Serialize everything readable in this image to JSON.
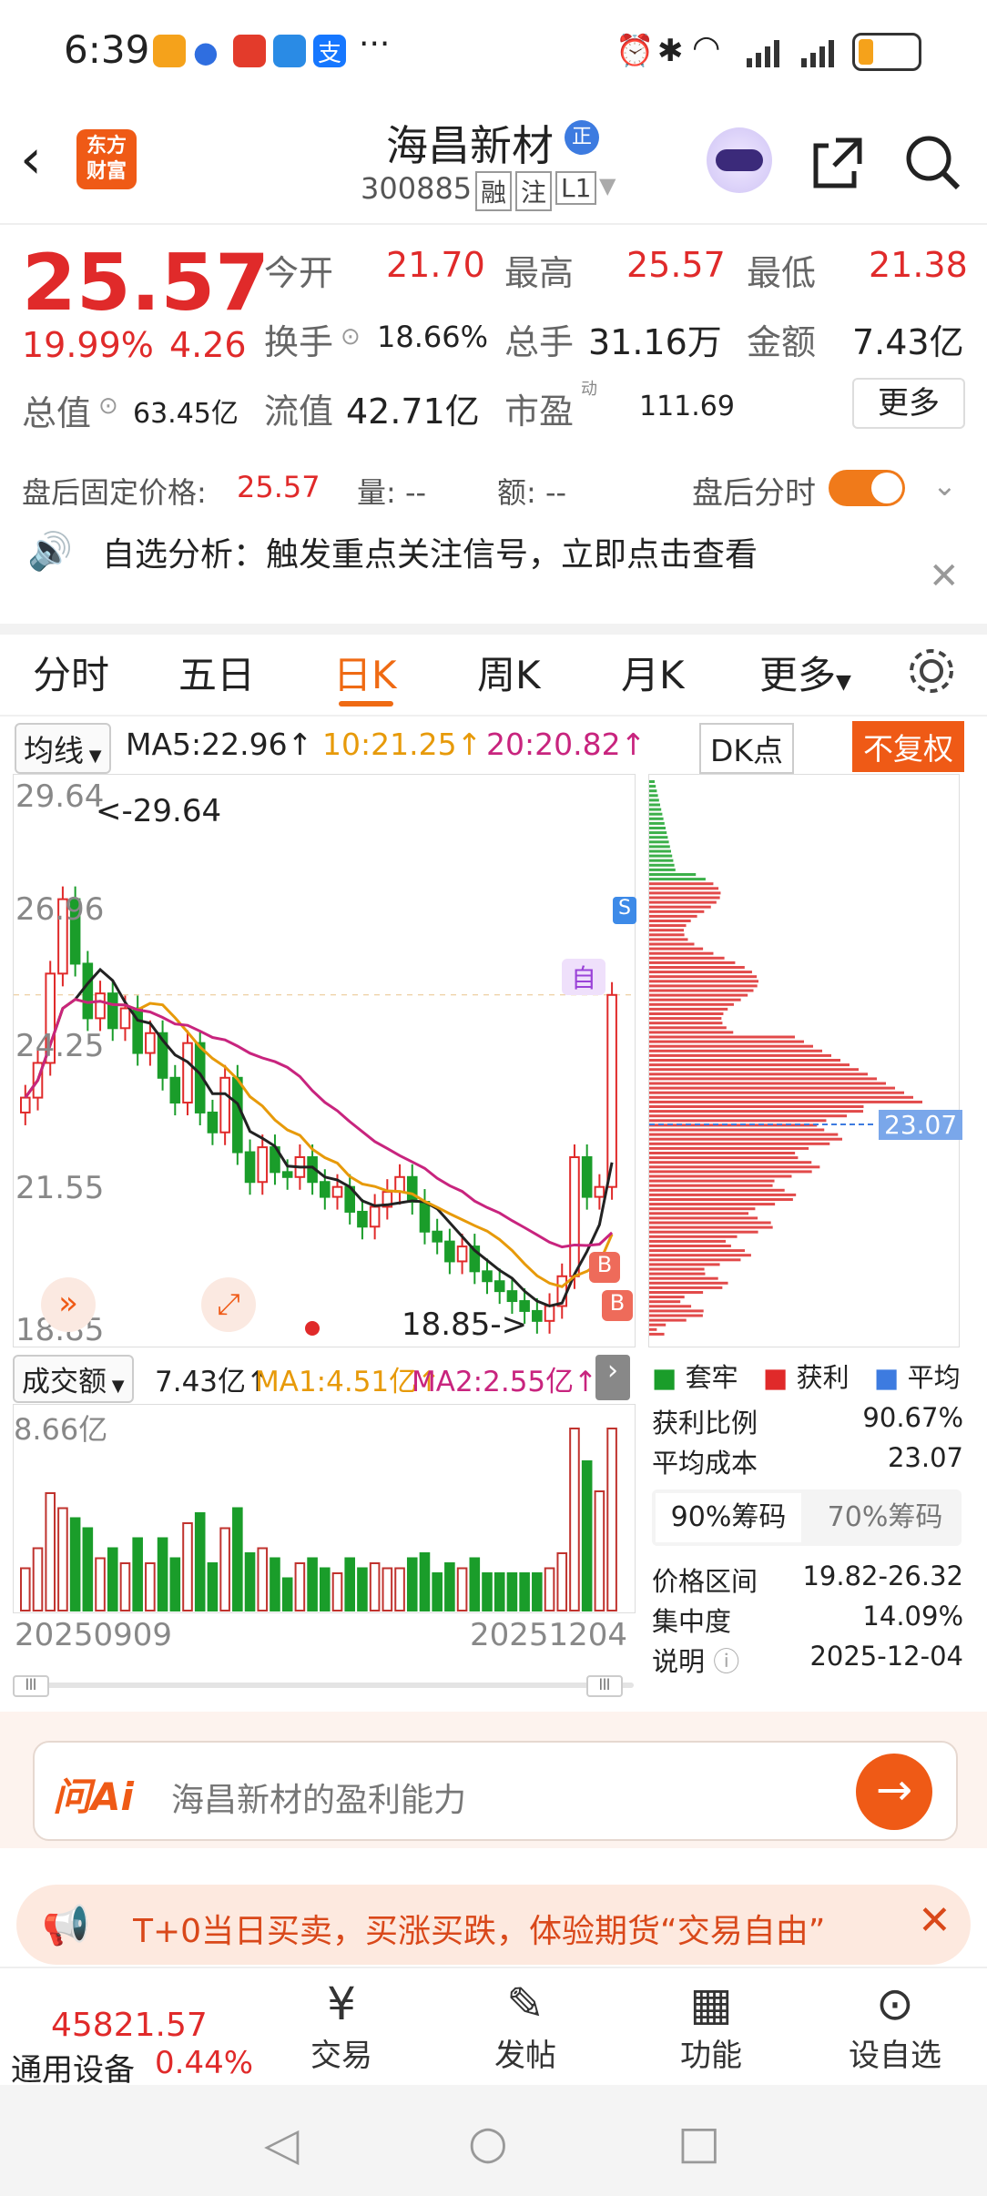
{
  "status": {
    "time": "6:39",
    "more": "···",
    "battery": "17"
  },
  "header": {
    "logo": "东方\n财富",
    "name": "海昌新材",
    "badge": "正",
    "code": "300885",
    "tags": [
      "融",
      "注",
      "L1"
    ]
  },
  "quote": {
    "price": "25.57",
    "pct": "19.99%",
    "change": "4.26",
    "open_label": "今开",
    "open": "21.70",
    "high_label": "最高",
    "high": "25.57",
    "low_label": "最低",
    "low": "21.38",
    "turnover_label": "换手",
    "turnover": "18.66%",
    "vol_label": "总手",
    "vol": "31.16万",
    "amount_label": "金额",
    "amount": "7.43亿",
    "mcap_label": "总值",
    "mcap": "63.45亿",
    "float_label": "流值",
    "float": "42.71亿",
    "pe_label": "市盈",
    "pe_sup": "动",
    "pe": "111.69",
    "more": "更多"
  },
  "after_hours": {
    "fixed_label": "盘后固定价格:",
    "fixed": "25.57",
    "qty_label": "量: --",
    "amt_label": "额: --",
    "intraday_label": "盘后分时"
  },
  "signal": {
    "text": "自选分析：触发重点关注信号，立即点击查看"
  },
  "tabs": [
    "分时",
    "五日",
    "日K",
    "周K",
    "月K",
    "更多"
  ],
  "ma": {
    "selector": "均线",
    "ma5": "MA5:22.96↑",
    "ma10": "10:21.25↑",
    "ma20": "20:20.82↑",
    "dk": "DK点",
    "fq": "不复权"
  },
  "chart": {
    "y_labels": [
      "29.64",
      "26.96",
      "24.25",
      "21.55",
      "18.85"
    ],
    "max_note": "<-29.64",
    "min_note": "18.85->",
    "mark_s": "S",
    "mark_zi": "自",
    "mark_b": "B",
    "cost_line": "23.07"
  },
  "chart_data": {
    "type": "candlestick",
    "x_range": [
      "20250909",
      "20251204"
    ],
    "ylim": [
      18.85,
      29.64
    ],
    "close": [
      23.5,
      24.2,
      26.0,
      27.5,
      26.2,
      25.1,
      25.6,
      24.9,
      25.3,
      24.4,
      24.8,
      23.9,
      23.4,
      24.6,
      23.2,
      22.8,
      23.9,
      22.4,
      21.8,
      22.5,
      22.0,
      21.9,
      22.3,
      21.8,
      21.5,
      21.7,
      21.2,
      20.9,
      21.3,
      21.6,
      21.9,
      21.4,
      20.8,
      20.6,
      20.2,
      20.5,
      20.0,
      19.8,
      19.6,
      19.4,
      19.2,
      19.0,
      19.3,
      19.9,
      22.3,
      21.5,
      21.7,
      25.57
    ],
    "ma5_last": 22.96,
    "ma10_last": 21.25,
    "ma20_last": 20.82
  },
  "volume": {
    "selector": "成交额",
    "value": "7.43亿↑",
    "ma1": "MA1:4.51亿↑",
    "ma2": "MA2:2.55亿↑",
    "top": "8.66亿",
    "start": "20250909",
    "end": "20251204"
  },
  "dist": {
    "legend": [
      "套牢",
      "获利",
      "平均"
    ],
    "rows": [
      {
        "label": "获利比例",
        "value": "90.67%"
      },
      {
        "label": "平均成本",
        "value": "23.07"
      },
      {
        "label": "价格区间",
        "value": "19.82-26.32"
      },
      {
        "label": "集中度",
        "value": "14.09%"
      },
      {
        "label": "说明",
        "value": "2025-12-04"
      }
    ],
    "tab_90": "90%筹码",
    "tab_70": "70%筹码"
  },
  "ai": {
    "logo": "问Ai",
    "placeholder": "海昌新材的盈利能力"
  },
  "banner": {
    "text": "T+0当日买卖，买涨买跌，体验期货“交易自由”"
  },
  "bottom": {
    "index_value": "45821.57",
    "index_name": "通用设备",
    "index_pct": "0.44%",
    "items": [
      "交易",
      "发帖",
      "功能",
      "设自选"
    ]
  },
  "colors": {
    "red": "#e02a2a",
    "green": "#1a9d2a",
    "orange": "#ef6a13",
    "magenta": "#c8247e",
    "gold": "#e79a0a"
  }
}
